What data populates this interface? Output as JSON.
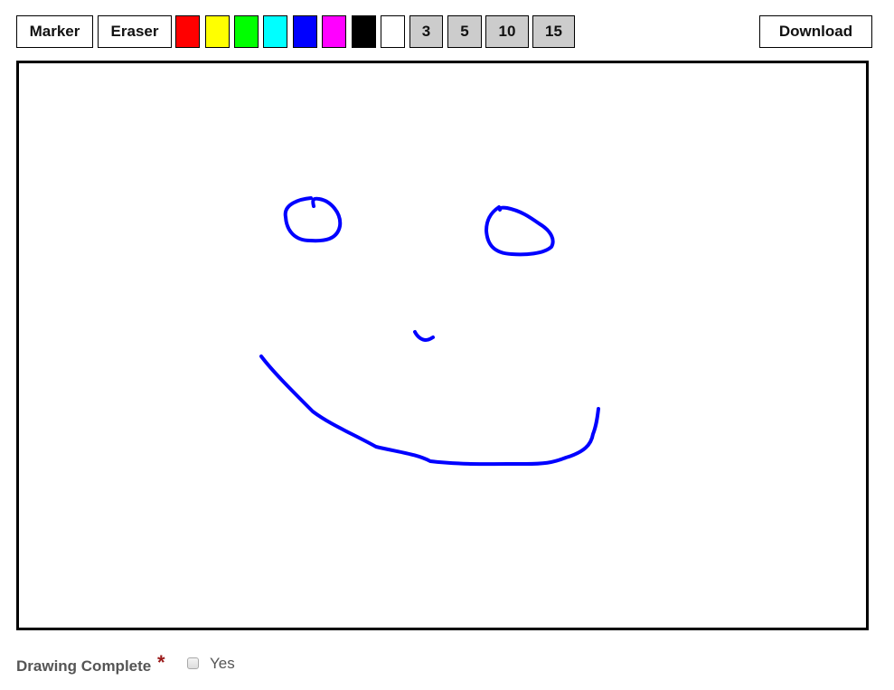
{
  "toolbar": {
    "tools": [
      {
        "id": "marker",
        "label": "Marker"
      },
      {
        "id": "eraser",
        "label": "Eraser"
      }
    ],
    "colors": [
      {
        "name": "red",
        "hex": "#ff0000"
      },
      {
        "name": "yellow",
        "hex": "#ffff00"
      },
      {
        "name": "green",
        "hex": "#00ff00"
      },
      {
        "name": "cyan",
        "hex": "#00ffff"
      },
      {
        "name": "blue",
        "hex": "#0000ff"
      },
      {
        "name": "magenta",
        "hex": "#ff00ff"
      },
      {
        "name": "black",
        "hex": "#000000"
      },
      {
        "name": "white",
        "hex": "#ffffff"
      }
    ],
    "sizes": [
      "3",
      "5",
      "10",
      "15"
    ],
    "download_label": "Download"
  },
  "canvas": {
    "stroke_color": "#0000ff",
    "description": "hand-drawn smiley face"
  },
  "footer": {
    "label": "Drawing Complete",
    "required_mark": "*",
    "checkbox_label": "Yes",
    "checked": false
  }
}
